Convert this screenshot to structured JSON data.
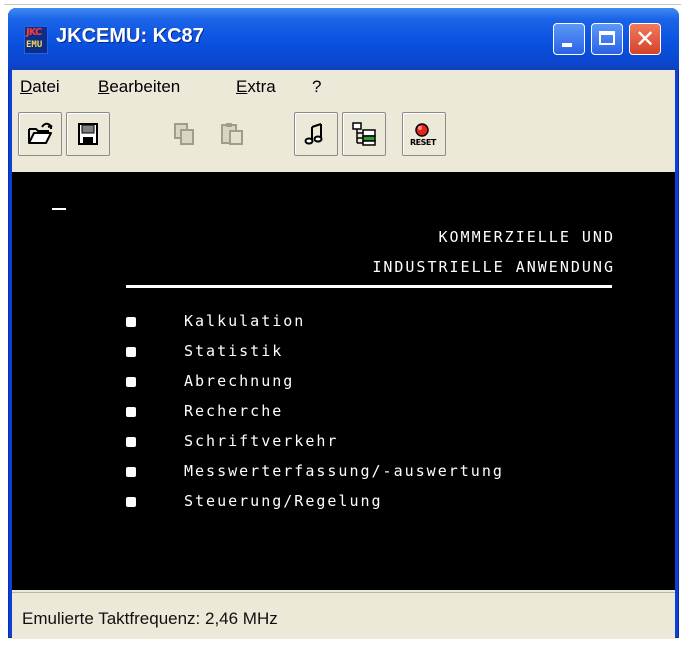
{
  "window": {
    "title": "JKCEMU: KC87",
    "icon": {
      "top": "JKC",
      "bottom": "EMU"
    }
  },
  "menu": [
    {
      "label": "Datei",
      "mnemonic": "D",
      "rest": "atei"
    },
    {
      "label": "Bearbeiten",
      "mnemonic": "B",
      "rest": "earbeiten"
    },
    {
      "label": "Extra",
      "mnemonic": "E",
      "rest": "xtra"
    },
    {
      "label": "?",
      "mnemonic": "",
      "rest": "?"
    }
  ],
  "toolbar": {
    "reset_label": "RESET",
    "buttons": [
      "open-file-icon",
      "save-icon",
      "copy-icon",
      "paste-icon",
      "audio-icon",
      "settings-icon",
      "reset-icon"
    ]
  },
  "screen": {
    "line1": "KOMMERZIELLE UND",
    "line2": "INDUSTRIELLE ANWENDUNG",
    "items": [
      "Kalkulation",
      "Statistik",
      "Abrechnung",
      "Recherche",
      "Schriftverkehr",
      "Messwerterfassung/-auswertung",
      "Steuerung/Regelung"
    ]
  },
  "status": {
    "text": "Emulierte Taktfrequenz: 2,46 MHz"
  }
}
